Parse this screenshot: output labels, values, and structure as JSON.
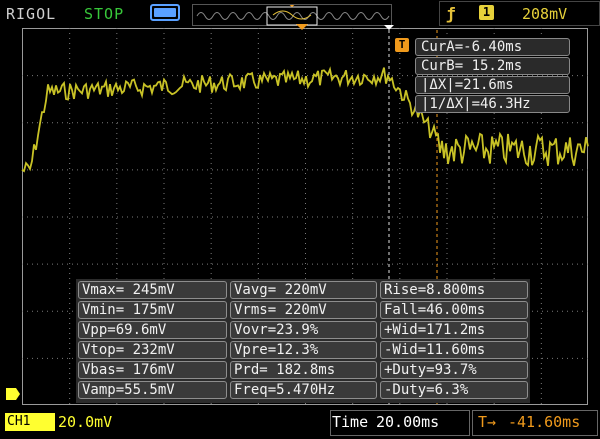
{
  "header": {
    "brand": "RIGOL",
    "run_state": "STOP",
    "run_state_color": "#38c83a",
    "memory_icon": "memory-bar-icon",
    "trigger_edge_icon": "rising-edge-icon",
    "trigger_source": "1",
    "trigger_level": "208mV"
  },
  "cursors": {
    "cur_a": "CurA=-6.40ms",
    "cur_b": "CurB= 15.2ms",
    "delta_x": "|ΔX|=21.6ms",
    "inv_delta_x": "|1/ΔX|=46.3Hz",
    "cursor_tag": "T"
  },
  "measurements": {
    "col1": [
      "Vmax= 245mV",
      "Vmin= 175mV",
      "Vpp=69.6mV",
      "Vtop= 232mV",
      "Vbas= 176mV",
      "Vamp=55.5mV"
    ],
    "col2": [
      "Vavg= 220mV",
      "Vrms= 220mV",
      "Vovr=23.9%",
      "Vpre=12.3%",
      "Prd= 182.8ms",
      "Freq=5.470Hz"
    ],
    "col3": [
      "Rise=8.800ms",
      "Fall=46.00ms",
      "+Wid=171.2ms",
      "-Wid=11.60ms",
      "+Duty=93.7%",
      "-Duty=6.3%"
    ]
  },
  "status": {
    "channel_label": "CH1",
    "channel_scale": "20.0mV",
    "time_label": "Time",
    "time_value": "20.00ms",
    "offset_icon": "trigger-position-arrow-icon",
    "offset_value": "-41.60ms"
  },
  "colors": {
    "trace": "#c8c226",
    "grid_dots": "#7a7a7a",
    "cursor_orange": "#f09a1c",
    "channel_yellow": "#ffff30"
  }
}
